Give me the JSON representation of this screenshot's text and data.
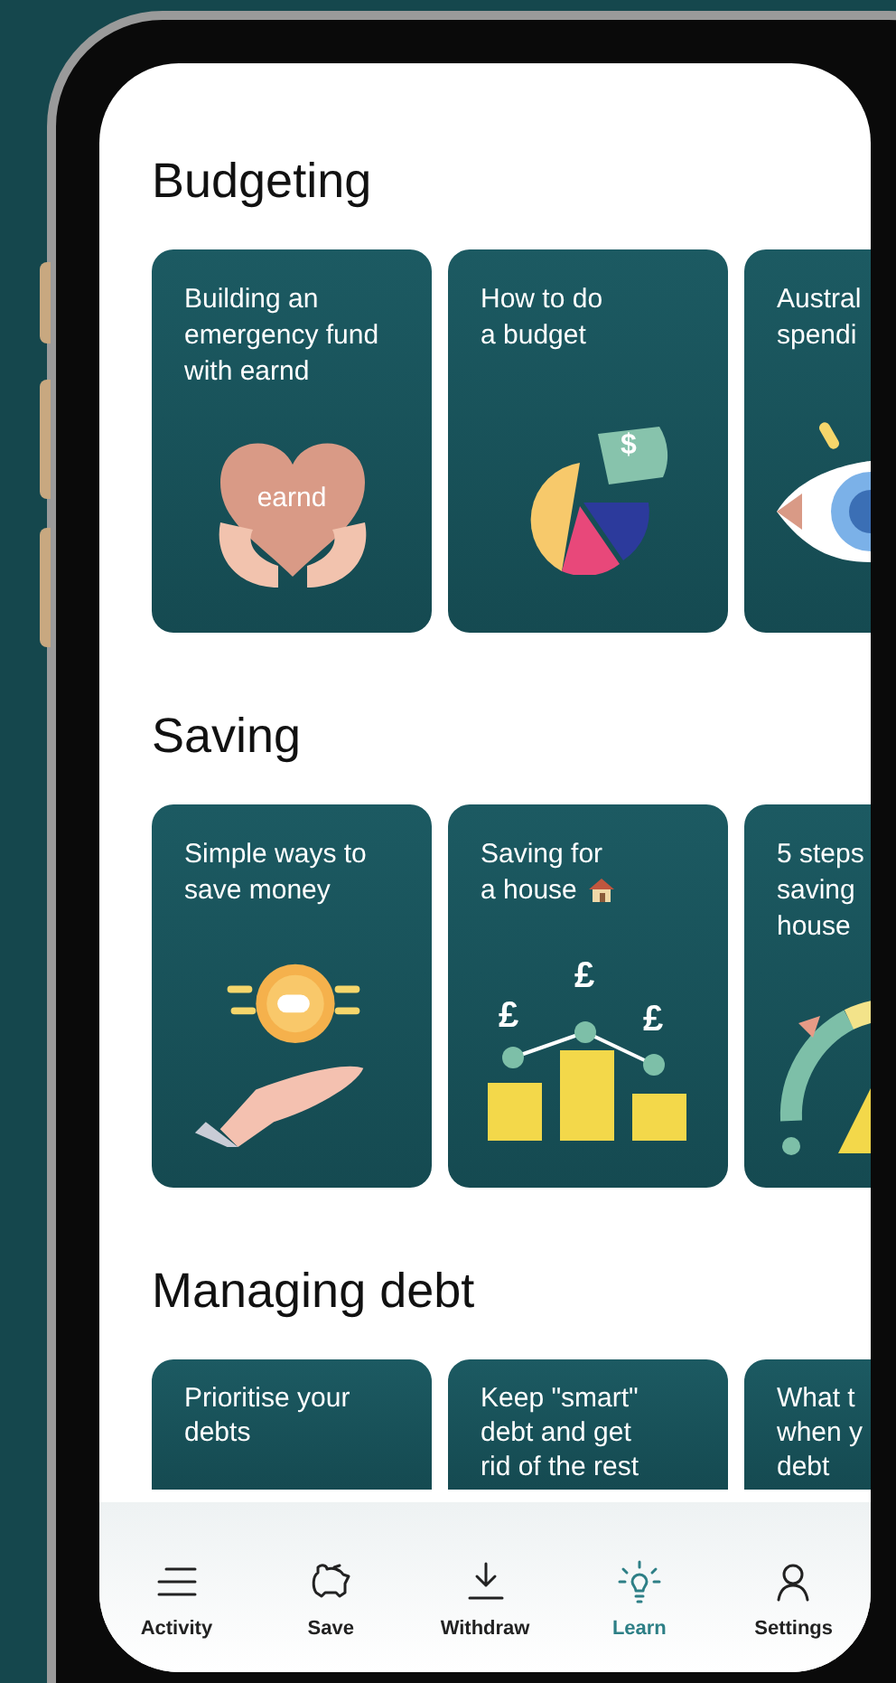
{
  "sections": [
    {
      "title": "Budgeting",
      "cards": [
        {
          "lines": [
            "Building an",
            "emergency fund",
            "with earnd"
          ],
          "kind": "heart",
          "art_text": [
            "earnd"
          ]
        },
        {
          "lines": [
            "How to do",
            "a budget"
          ],
          "kind": "pie",
          "art_text": [
            "$"
          ]
        },
        {
          "lines": [
            "Austral",
            "spendi"
          ],
          "kind": "eye"
        }
      ]
    },
    {
      "title": "Saving",
      "cards": [
        {
          "lines": [
            "Simple ways to",
            "save money"
          ],
          "kind": "coin"
        },
        {
          "lines": [
            "Saving for",
            "a house"
          ],
          "kind": "coins",
          "art_text": [
            "£",
            "£",
            "£"
          ],
          "trailing_icon": true
        },
        {
          "lines": [
            "5 steps",
            "saving",
            "house"
          ],
          "kind": "gauge"
        }
      ]
    },
    {
      "title": "Managing debt",
      "cards": [
        {
          "lines": [
            "Prioritise your",
            "debts"
          ],
          "kind": "text"
        },
        {
          "lines": [
            "Keep \"smart\"",
            "debt and get",
            "rid of the rest"
          ],
          "kind": "text"
        },
        {
          "lines": [
            "What t",
            "when y",
            "debt"
          ],
          "kind": "text"
        }
      ]
    }
  ],
  "nav": [
    {
      "label": "Activity",
      "kind": "lines",
      "selected": false
    },
    {
      "label": "Save",
      "kind": "piggy",
      "selected": false
    },
    {
      "label": "Withdraw",
      "kind": "download",
      "selected": false
    },
    {
      "label": "Learn",
      "kind": "bulb",
      "selected": true
    },
    {
      "label": "Settings",
      "kind": "person",
      "selected": false
    }
  ]
}
